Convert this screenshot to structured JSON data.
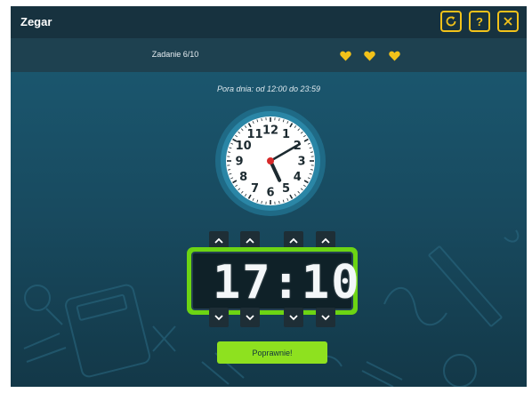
{
  "app": {
    "title": "Zegar",
    "buttons": {
      "restart_icon": "refresh-icon",
      "help_label": "?",
      "close_icon": "close-icon"
    },
    "accent_color": "#f2c21a"
  },
  "task": {
    "label": "Zadanie 6/10",
    "lives": 3,
    "heart_color": "#f2c21a"
  },
  "time_range": "Pora dnia: od 12:00 do 23:59",
  "analog_clock": {
    "numbers": [
      "12",
      "1",
      "2",
      "3",
      "4",
      "5",
      "6",
      "7",
      "8",
      "9",
      "10",
      "11"
    ],
    "hour": 5,
    "minute": 10
  },
  "digital_clock": {
    "display": "17:10",
    "color": "#6cd413"
  },
  "submit": {
    "label": "Poprawnie!"
  }
}
